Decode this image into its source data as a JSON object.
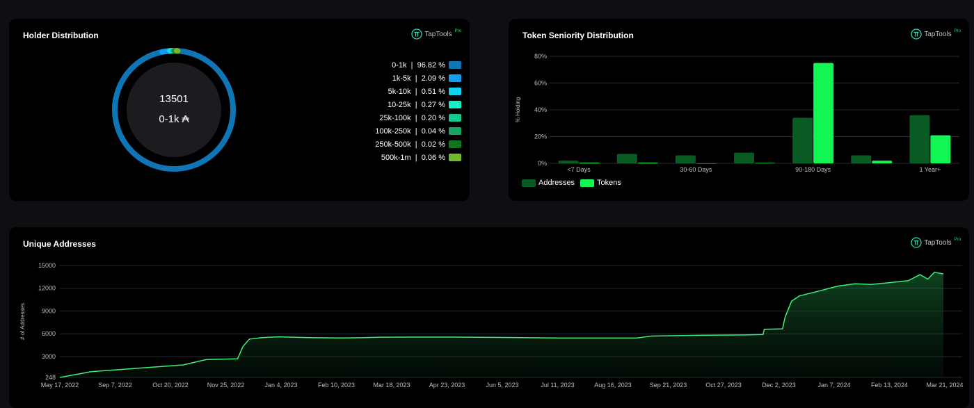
{
  "holder": {
    "title": "Holder Distribution",
    "center_value": "13501",
    "center_label": "0-1k ₳",
    "legend": [
      {
        "range": "0-1k",
        "pct": "96.82 %",
        "value": 96.82,
        "color": "#0f75b5"
      },
      {
        "range": "1k-5k",
        "pct": "2.09 %",
        "value": 2.09,
        "color": "#139cf0"
      },
      {
        "range": "5k-10k",
        "pct": "0.51 %",
        "value": 0.51,
        "color": "#0fd3f0"
      },
      {
        "range": "10-25k",
        "pct": "0.27 %",
        "value": 0.27,
        "color": "#12f0c6"
      },
      {
        "range": "25k-100k",
        "pct": "0.20 %",
        "value": 0.2,
        "color": "#14c992"
      },
      {
        "range": "100k-250k",
        "pct": "0.04 %",
        "value": 0.04,
        "color": "#15a766"
      },
      {
        "range": "250k-500k",
        "pct": "0.02 %",
        "value": 0.02,
        "color": "#12761f"
      },
      {
        "range": "500k-1m",
        "pct": "0.06 %",
        "value": 0.06,
        "color": "#6fbb2c"
      }
    ]
  },
  "brand": {
    "name": "TapTools",
    "suffix": "Pro"
  },
  "seniority": {
    "title": "Token Seniority Distribution"
  },
  "unique": {
    "title": "Unique Addresses"
  },
  "chart_data": [
    {
      "type": "bar",
      "title": "Token Seniority Distribution",
      "ylabel": "% Holding",
      "ylim": [
        0,
        80
      ],
      "yticks": [
        "0%",
        "20%",
        "40%",
        "60%",
        "80%"
      ],
      "categories": [
        "<7 Days",
        "",
        "30-60 Days",
        "",
        "90-180 Days",
        "",
        "1 Year+"
      ],
      "xlabels": [
        "<7 Days",
        "30-60 Days",
        "90-180 Days",
        "1 Year+"
      ],
      "series": [
        {
          "name": "Addresses",
          "color": "#0a5a24",
          "values": [
            2,
            7,
            6,
            8,
            34,
            6,
            36
          ]
        },
        {
          "name": "Tokens",
          "color": "#12f653",
          "values": [
            0.5,
            0.5,
            0,
            0.3,
            75,
            2,
            21
          ]
        }
      ],
      "legend": "bottom-left"
    },
    {
      "type": "area",
      "title": "Unique Addresses",
      "ylabel": "# of Addresses",
      "yticks": [
        "248",
        "3000",
        "6000",
        "9000",
        "12000",
        "15000"
      ],
      "ytick_values": [
        248,
        3000,
        6000,
        9000,
        12000,
        15000
      ],
      "ylim": [
        248,
        15000
      ],
      "xticks": [
        "May 17, 2022",
        "Sep 7, 2022",
        "Oct 20, 2022",
        "Nov 25, 2022",
        "Jan 4, 2023",
        "Feb 10, 2023",
        "Mar 18, 2023",
        "Apr 23, 2023",
        "Jun 5, 2023",
        "Jul 11, 2023",
        "Aug 16, 2023",
        "Sep 21, 2023",
        "Oct 27, 2023",
        "Dec 2, 2023",
        "Jan 7, 2024",
        "Feb 13, 2024",
        "Mar 21, 2024"
      ],
      "line_color": "#3cf07a",
      "points": [
        [
          "May 17, 2022",
          248
        ],
        [
          "Jun 10, 2022",
          1000
        ],
        [
          "Jul 20, 2022",
          1500
        ],
        [
          "Aug 20, 2022",
          1900
        ],
        [
          "Sep 7, 2022",
          2600
        ],
        [
          "Oct 1, 2022",
          2700
        ],
        [
          "Oct 5, 2022",
          4300
        ],
        [
          "Oct 10, 2022",
          5300
        ],
        [
          "Oct 20, 2022",
          5500
        ],
        [
          "Nov 1, 2022",
          5600
        ],
        [
          "Nov 25, 2022",
          5500
        ],
        [
          "Dec 20, 2022",
          5450
        ],
        [
          "Jan 4, 2023",
          5480
        ],
        [
          "Jan 20, 2023",
          5550
        ],
        [
          "Feb 10, 2023",
          5560
        ],
        [
          "Mar 18, 2023",
          5560
        ],
        [
          "Apr 23, 2023",
          5520
        ],
        [
          "Jun 5, 2023",
          5450
        ],
        [
          "Jul 11, 2023",
          5450
        ],
        [
          "Aug 5, 2023",
          5450
        ],
        [
          "Aug 16, 2023",
          5700
        ],
        [
          "Sep 21, 2023",
          5800
        ],
        [
          "Oct 27, 2023",
          5850
        ],
        [
          "Nov 10, 2023",
          5900
        ],
        [
          "Nov 11, 2023",
          6600
        ],
        [
          "Nov 25, 2023",
          6650
        ],
        [
          "Nov 27, 2023",
          8200
        ],
        [
          "Dec 2, 2023",
          10300
        ],
        [
          "Dec 8, 2023",
          11000
        ],
        [
          "Dec 20, 2023",
          11500
        ],
        [
          "Jan 7, 2024",
          12300
        ],
        [
          "Jan 20, 2024",
          12600
        ],
        [
          "Feb 1, 2024",
          12500
        ],
        [
          "Feb 13, 2024",
          12700
        ],
        [
          "Mar 1, 2024",
          13000
        ],
        [
          "Mar 10, 2024",
          13800
        ],
        [
          "Mar 16, 2024",
          13200
        ],
        [
          "Mar 21, 2024",
          14100
        ],
        [
          "Mar 28, 2024",
          13900
        ]
      ]
    }
  ]
}
